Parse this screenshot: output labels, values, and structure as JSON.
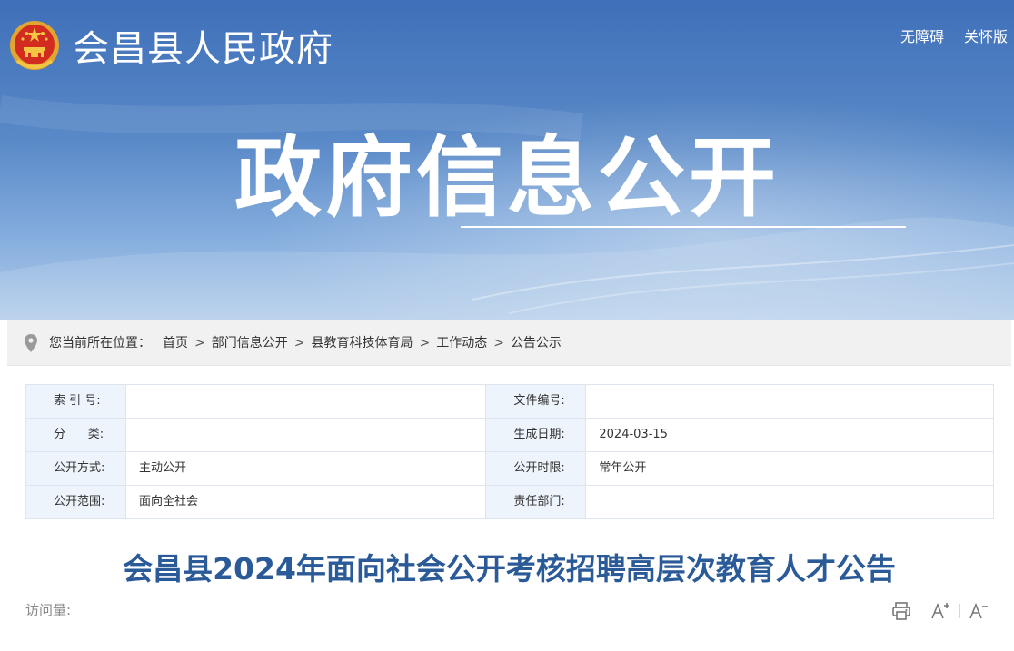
{
  "header": {
    "site_title": "会昌县人民政府",
    "links": {
      "accessibility": "无障碍",
      "care_mode": "关怀版"
    },
    "hero_heading": "政府信息公开"
  },
  "breadcrumb": {
    "label": "您当前所在位置：",
    "items": [
      "首页",
      "部门信息公开",
      "县教育科技体育局",
      "工作动态",
      "公告公示"
    ],
    "separator": ">"
  },
  "meta_table": {
    "rows": [
      {
        "k1": "索 引 号:",
        "v1": "",
        "k2": "文件编号:",
        "v2": ""
      },
      {
        "k1": "分      类:",
        "v1": "",
        "k2": "生成日期:",
        "v2": "2024-03-15"
      },
      {
        "k1": "公开方式:",
        "v1": "主动公开",
        "k2": "公开时限:",
        "v2": "常年公开"
      },
      {
        "k1": "公开范围:",
        "v1": "面向全社会",
        "k2": "责任部门:",
        "v2": ""
      }
    ]
  },
  "article": {
    "title": "会昌县2024年面向社会公开考核招聘高层次教育人才公告",
    "visits_label": "访问量:"
  },
  "toolbar": {
    "print_icon": "printer-icon",
    "increase_font_icon": "font-increase-icon",
    "decrease_font_icon": "font-decrease-icon"
  },
  "colors": {
    "hero_top": "#3f6fb8",
    "hero_bottom": "#b3cdea",
    "title_blue": "#2a5a97",
    "meta_key_bg": "#eef4fc",
    "breadcrumb_bg": "#f1f1f1"
  }
}
